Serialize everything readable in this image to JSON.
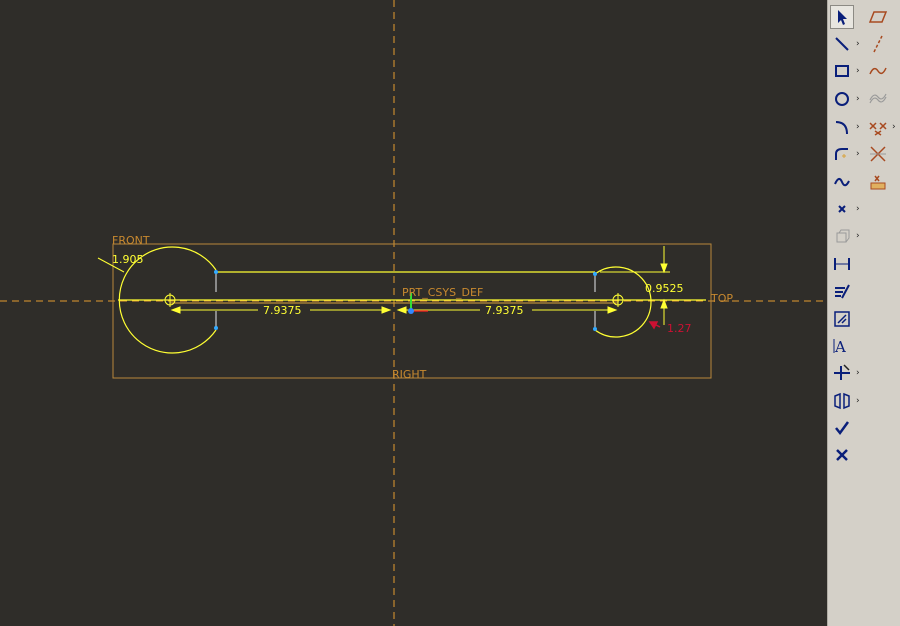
{
  "sketch": {
    "datums": {
      "front": "FRONT",
      "top": "TOP",
      "right": "RIGHT",
      "csys": "PRT_CSYS_DEF"
    },
    "dimensions": {
      "radius_left": "1.905",
      "dist_left": "7.9375",
      "dist_right": "7.9375",
      "offset": "0.9525",
      "radius_right": "1.27"
    }
  },
  "toolbar": {
    "left_column": [
      {
        "icon": "select-arrow-icon",
        "active": true
      },
      {
        "icon": "line-icon",
        "flyout": true
      },
      {
        "icon": "rectangle-icon",
        "flyout": true
      },
      {
        "icon": "circle-icon",
        "flyout": true
      },
      {
        "icon": "arc-icon",
        "flyout": true
      },
      {
        "icon": "fillet-icon",
        "flyout": true
      },
      {
        "icon": "spline-icon"
      },
      {
        "icon": "point-icon",
        "flyout": true
      },
      {
        "icon": "use-edge-icon",
        "flyout": true
      },
      {
        "icon": "dimension-icon"
      },
      {
        "icon": "modify-icon"
      },
      {
        "icon": "constraints-icon"
      },
      {
        "icon": "text-icon"
      },
      {
        "icon": "trim-icon",
        "flyout": true
      },
      {
        "icon": "mirror-icon",
        "flyout": true
      },
      {
        "icon": "accept-check-icon"
      },
      {
        "icon": "cancel-x-icon"
      }
    ],
    "right_column": [
      {
        "icon": "parallelogram-icon"
      },
      {
        "icon": "construction-line-icon"
      },
      {
        "icon": "sketched-curve-icon"
      },
      {
        "icon": "offset-curve-icon"
      },
      {
        "icon": "delete-segment-icon",
        "flyout": true
      },
      {
        "icon": "divide-icon"
      },
      {
        "icon": "palette-icon"
      }
    ]
  },
  "colors": {
    "background": "#2f2d29",
    "datum": "#e39a30",
    "geometry": "#ffff33",
    "strong_dim": "#cc1133",
    "toolbar": "#d4d0c8",
    "icon": "#0a1f7a"
  }
}
